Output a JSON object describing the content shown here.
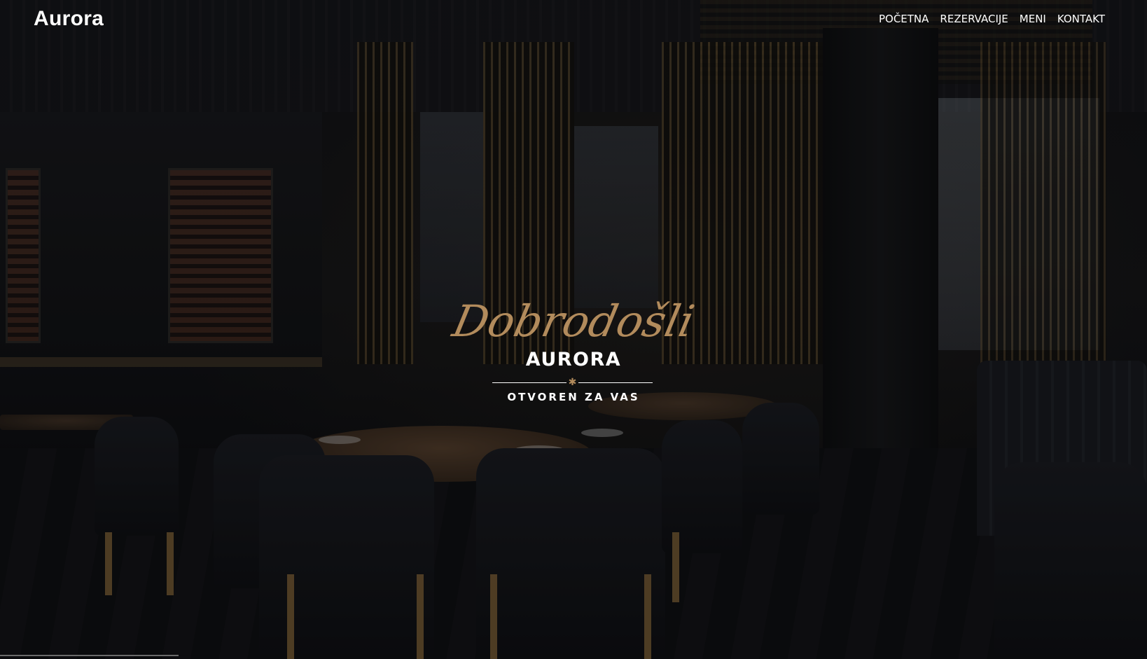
{
  "header": {
    "brand": "Aurora",
    "nav": [
      {
        "label": "POČETNA"
      },
      {
        "label": "REZERVACIJE"
      },
      {
        "label": "MENI"
      },
      {
        "label": "KONTAKT"
      }
    ]
  },
  "hero": {
    "script_heading": "Dobrodošli",
    "title": "AURORA",
    "divider_icon": "star-icon",
    "subtitle": "OTVOREN ZA VAS",
    "background_image": "restaurant-interior-photo",
    "accent_color": "#b28b5c"
  }
}
